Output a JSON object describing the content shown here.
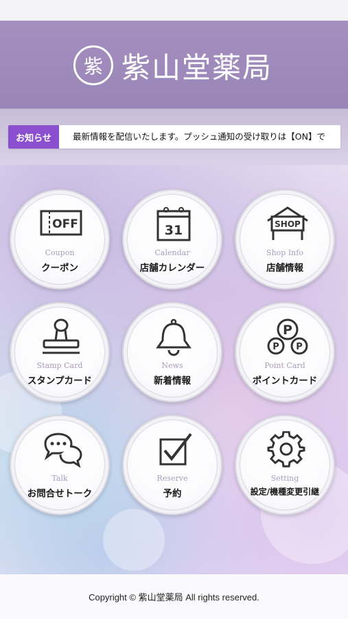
{
  "header": {
    "logo_mark": "紫",
    "title": "紫山堂薬局"
  },
  "news": {
    "label": "お知らせ",
    "text": "最新情報を配信いたします。プッシュ通知の受け取りは【ON】で"
  },
  "menu": [
    {
      "en": "Coupon",
      "ja": "クーポン",
      "icon": "coupon-off-icon",
      "icon_text": "OFF"
    },
    {
      "en": "Calendar",
      "ja": "店舗カレンダー",
      "icon": "calendar-icon",
      "icon_text": "31"
    },
    {
      "en": "Shop Info",
      "ja": "店舗情報",
      "icon": "shop-icon",
      "icon_text": "SHOP"
    },
    {
      "en": "Stamp Card",
      "ja": "スタンプカード",
      "icon": "stamp-icon"
    },
    {
      "en": "News",
      "ja": "新着情報",
      "icon": "bell-icon"
    },
    {
      "en": "Point Card",
      "ja": "ポイントカード",
      "icon": "points-icon",
      "icon_text": "P"
    },
    {
      "en": "Talk",
      "ja": "お問合せトーク",
      "icon": "chat-icon"
    },
    {
      "en": "Reserve",
      "ja": "予約",
      "icon": "checkbox-icon"
    },
    {
      "en": "Setting",
      "ja": "設定/機種変更引継",
      "icon": "gear-icon"
    }
  ],
  "footer": {
    "copyright": "Copyright © 紫山堂薬局 All rights reserved."
  },
  "colors": {
    "header": "#9a85b8",
    "news_label": "#8a4fcf",
    "label_en": "#a89cbc"
  }
}
